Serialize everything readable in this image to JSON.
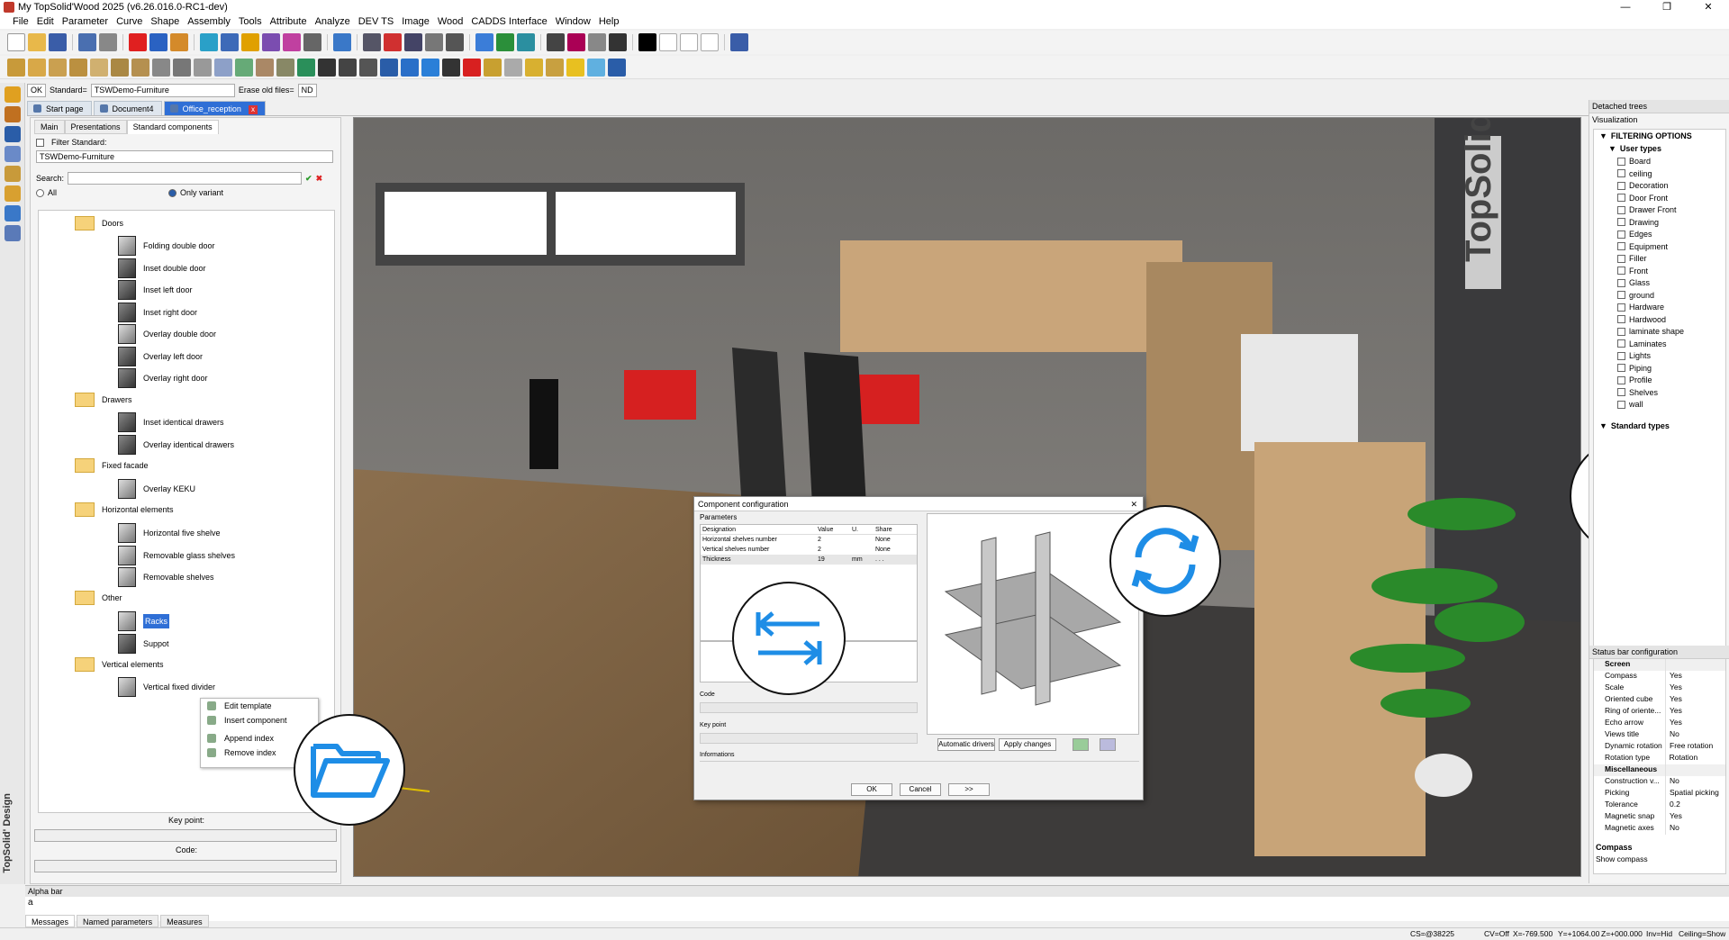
{
  "window": {
    "title": "My TopSolid'Wood 2025 (v6.26.016.0-RC1-dev)",
    "controls": [
      "—",
      "❐",
      "✕"
    ]
  },
  "menu": [
    "File",
    "Edit",
    "Parameter",
    "Curve",
    "Shape",
    "Assembly",
    "Tools",
    "Attribute",
    "Analyze",
    "DEV TS",
    "Image",
    "Wood",
    "CADDS Interface",
    "Window",
    "Help"
  ],
  "option_bar": {
    "ok": "OK",
    "standard_label": "Standard=",
    "standard_value": "TSWDemo-Furniture",
    "erase_label": "Erase old files=",
    "nd": "ND"
  },
  "doc_tabs": [
    {
      "label": "Start page"
    },
    {
      "label": "Document4"
    },
    {
      "label": "Office_reception",
      "close": "x"
    }
  ],
  "left_panel": {
    "tabs": [
      "Main",
      "Presentations",
      "Standard components"
    ],
    "filter_label": "Filter Standard:",
    "standard_value": "TSWDemo-Furniture",
    "search_label": "Search:",
    "radio_all": "All",
    "radio_only_variant": "Only variant",
    "tree": [
      {
        "type": "folder",
        "label": "Doors"
      },
      {
        "type": "item",
        "label": "Folding double door"
      },
      {
        "type": "item",
        "label": "Inset double door"
      },
      {
        "type": "item",
        "label": "Inset left door"
      },
      {
        "type": "item",
        "label": "Inset right door"
      },
      {
        "type": "item",
        "label": "Overlay double door"
      },
      {
        "type": "item",
        "label": "Overlay left door"
      },
      {
        "type": "item",
        "label": "Overlay right door"
      },
      {
        "type": "folder",
        "label": "Drawers"
      },
      {
        "type": "item",
        "label": "Inset identical drawers"
      },
      {
        "type": "item",
        "label": "Overlay identical drawers"
      },
      {
        "type": "folder",
        "label": "Fixed facade"
      },
      {
        "type": "item",
        "label": "Overlay KEKU"
      },
      {
        "type": "folder",
        "label": "Horizontal elements"
      },
      {
        "type": "item",
        "label": "Horizontal five shelve"
      },
      {
        "type": "item",
        "label": "Removable glass shelves"
      },
      {
        "type": "item",
        "label": "Removable shelves"
      },
      {
        "type": "folder",
        "label": "Other"
      },
      {
        "type": "item",
        "label": "Racks",
        "selected": true
      },
      {
        "type": "item",
        "label": "Suppot"
      },
      {
        "type": "folder",
        "label": "Vertical elements"
      },
      {
        "type": "item",
        "label": "Vertical fixed divider"
      }
    ],
    "key_point_label": "Key point:",
    "code_label": "Code:"
  },
  "context_menu": [
    "Edit template",
    "Insert component",
    "Append index",
    "Remove index"
  ],
  "dialog": {
    "title": "Component configuration",
    "group": "Parameters",
    "columns": [
      "Designation",
      "Value",
      "U.",
      "Share"
    ],
    "rows": [
      {
        "designation": "Horizontal shelves number",
        "value": "2",
        "unit": "",
        "share": "None"
      },
      {
        "designation": "Vertical shelves number",
        "value": "2",
        "unit": "",
        "share": "None"
      },
      {
        "designation": "Thickness",
        "value": "19",
        "unit": "mm",
        "share": ". . ."
      }
    ],
    "code_label": "Code",
    "key_point_label": "Key point",
    "informations_label": "Informations",
    "btn_auto_drivers": "Automatic drivers",
    "btn_apply_changes": "Apply changes",
    "btn_ok": "OK",
    "btn_cancel": "Cancel",
    "btn_more": ">>"
  },
  "viewport_logo": "TopSolid",
  "right_panel": {
    "title": "Detached trees",
    "subtitle": "Visualization",
    "filter_header": "FILTERING OPTIONS",
    "user_types_label": "User types",
    "user_types": [
      "Board",
      "ceiling",
      "Decoration",
      "Door Front",
      "Drawer Front",
      "Drawing",
      "Edges",
      "Equipment",
      "Filler",
      "Front",
      "Glass",
      "ground",
      "Hardware",
      "Hardwood",
      "laminate shape",
      "Laminates",
      "Lights",
      "Piping",
      "Profile",
      "Shelves",
      "wall"
    ],
    "standard_types_label": "Standard types",
    "status_config_title": "Status bar configuration",
    "status_sections": [
      {
        "section": "Screen",
        "rows": [
          [
            "Compass",
            "Yes"
          ],
          [
            "Scale",
            "Yes"
          ],
          [
            "Oriented cube",
            "Yes"
          ],
          [
            "Ring of oriente...",
            "Yes"
          ],
          [
            "Echo arrow",
            "Yes"
          ],
          [
            "Views title",
            "No"
          ],
          [
            "Dynamic rotation",
            "Free rotation"
          ],
          [
            "Rotation type",
            "Rotation aroun..."
          ]
        ]
      },
      {
        "section": "Miscellaneous",
        "rows": [
          [
            "Construction v...",
            "No"
          ],
          [
            "Picking",
            "Spatial picking"
          ],
          [
            "Tolerance",
            "0.2"
          ],
          [
            "Magnetic snap",
            "Yes"
          ],
          [
            "Magnetic axes",
            "No"
          ]
        ]
      }
    ],
    "compass_title": "Compass",
    "compass_desc": "Show compass"
  },
  "alpha_bar": {
    "title": "Alpha bar",
    "input": "a"
  },
  "bottom_tabs": [
    "Messages",
    "Named parameters",
    "Measures"
  ],
  "status_bar": {
    "cs": "CS=@38225",
    "cv": "CV=Off",
    "x": "X=-769.500",
    "y": "Y=+1064.00",
    "z": "Z=+000.000",
    "inv": "Inv=Hid",
    "ceiling": "Ceiling=Show"
  },
  "brand_vertical": "TopSolid' Design",
  "colors": {
    "accent_blue": "#2f6fd6",
    "icon_blue": "#1e8de6",
    "folder": "#f6d27a"
  }
}
